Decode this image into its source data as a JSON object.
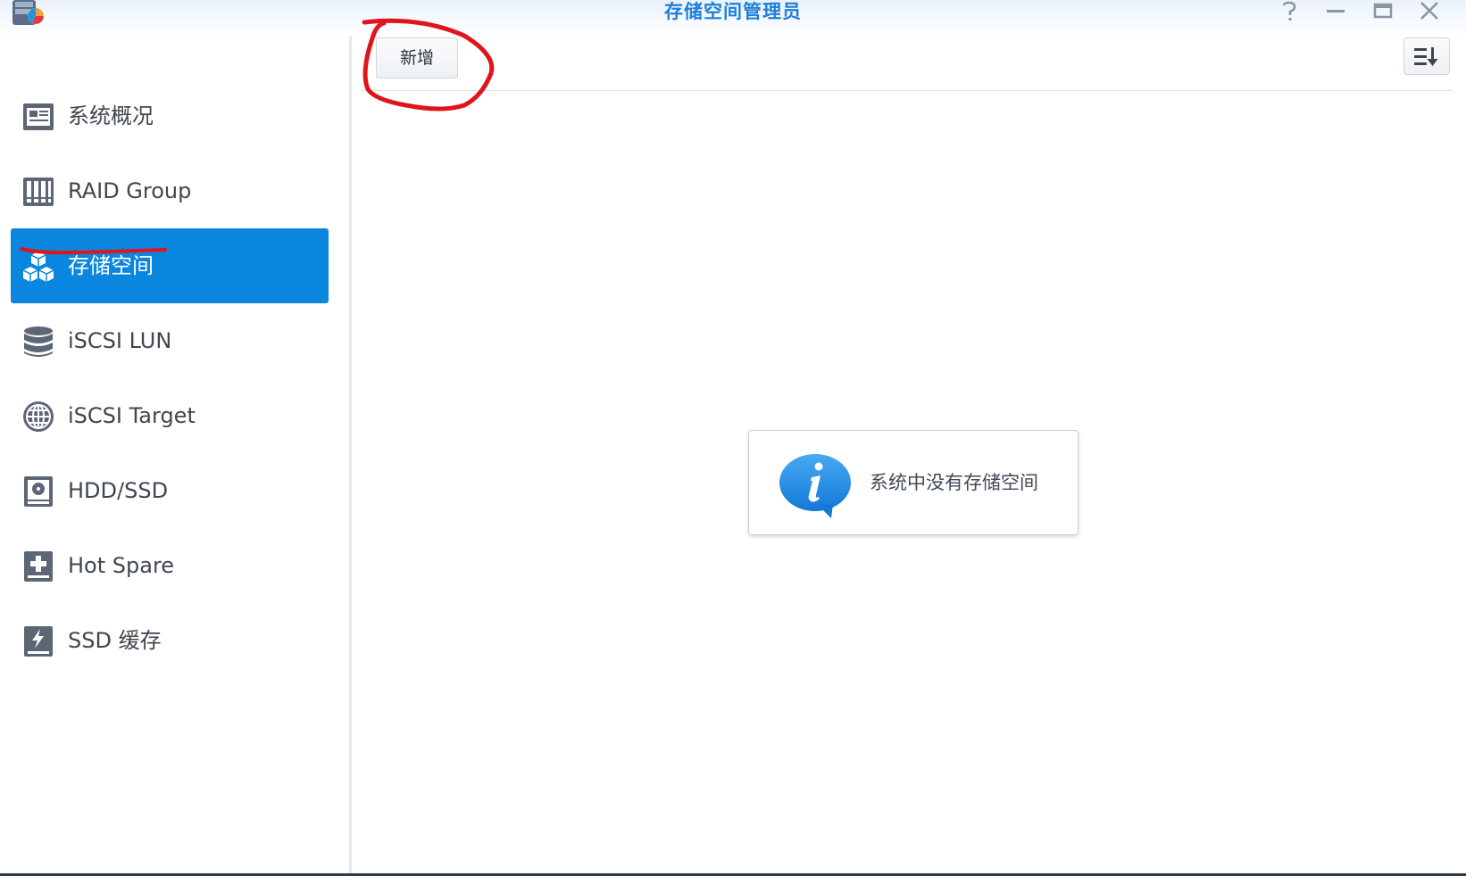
{
  "window": {
    "title": "存储空间管理员"
  },
  "sidebar": {
    "items": [
      {
        "label": "系统概况",
        "icon": "overview-icon"
      },
      {
        "label": "RAID Group",
        "icon": "raid-group-icon"
      },
      {
        "label": "存储空间",
        "icon": "storage-cubes-icon",
        "active": true
      },
      {
        "label": "iSCSI LUN",
        "icon": "database-icon"
      },
      {
        "label": "iSCSI Target",
        "icon": "globe-icon"
      },
      {
        "label": "HDD/SSD",
        "icon": "hdd-icon"
      },
      {
        "label": "Hot Spare",
        "icon": "hot-spare-icon"
      },
      {
        "label": "SSD 缓存",
        "icon": "ssd-cache-icon"
      }
    ]
  },
  "toolbar": {
    "add_label": "新增"
  },
  "main": {
    "empty_message": "系统中没有存储空间"
  },
  "colors": {
    "accent": "#0a86de",
    "title": "#1f7fd6",
    "annotation": "#e0141b"
  }
}
